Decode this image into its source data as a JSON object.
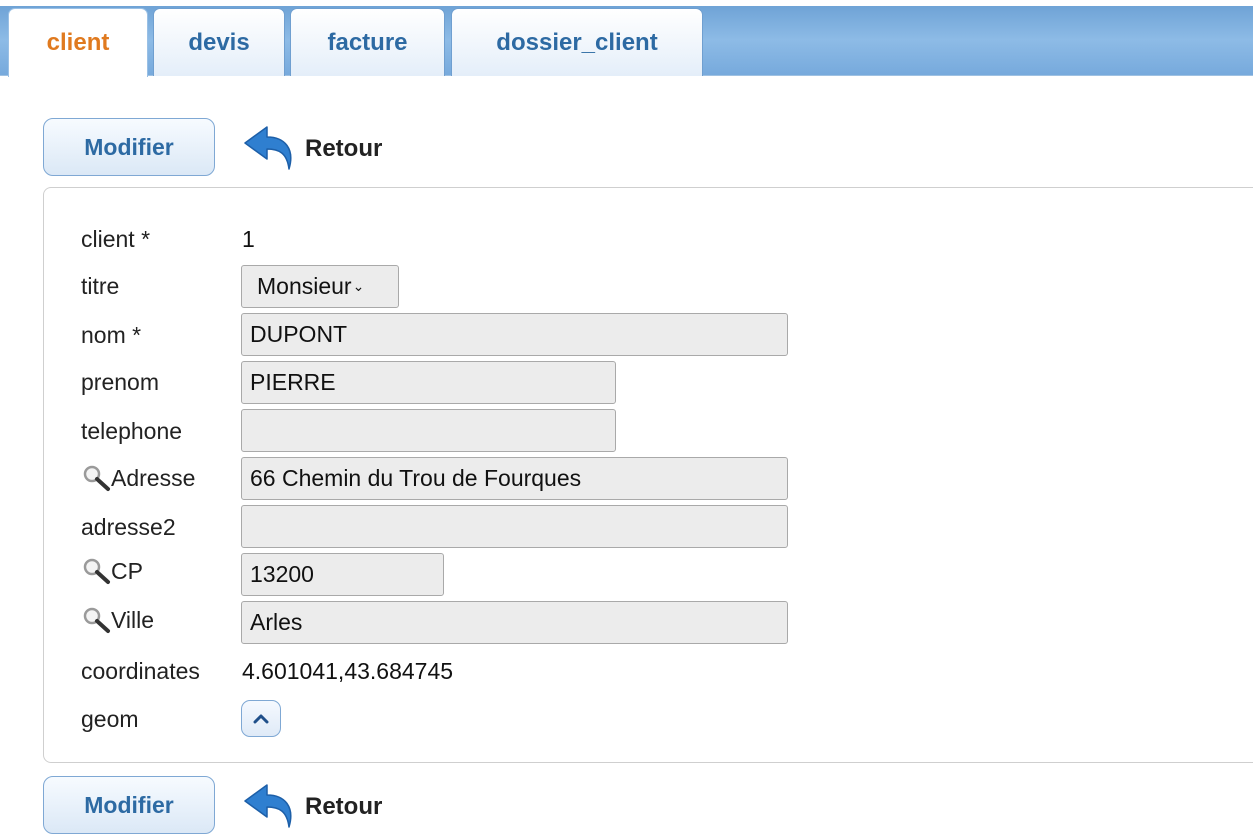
{
  "tabs": [
    {
      "label": "client",
      "active": true
    },
    {
      "label": "devis",
      "active": false
    },
    {
      "label": "facture",
      "active": false
    },
    {
      "label": "dossier_client",
      "active": false
    }
  ],
  "toolbar": {
    "modifier_label": "Modifier",
    "retour_label": "Retour"
  },
  "form": {
    "client": {
      "label": "client *",
      "value": "1"
    },
    "titre": {
      "label": "titre",
      "value": "Monsieur"
    },
    "nom": {
      "label": "nom *",
      "value": "DUPONT"
    },
    "prenom": {
      "label": "prenom",
      "value": "PIERRE"
    },
    "telephone": {
      "label": "telephone",
      "value": ""
    },
    "adresse": {
      "label": "Adresse",
      "value": "66 Chemin du Trou de Fourques"
    },
    "adresse2": {
      "label": "adresse2",
      "value": ""
    },
    "cp": {
      "label": "CP",
      "value": "13200"
    },
    "ville": {
      "label": "Ville",
      "value": "Arles"
    },
    "coordinates": {
      "label": "coordinates",
      "value": "4.601041,43.684745"
    },
    "geom": {
      "label": "geom"
    }
  },
  "colors": {
    "accent": "#2d6aa3",
    "active_tab": "#e07a1f",
    "tabbar": "#7fb0df"
  }
}
